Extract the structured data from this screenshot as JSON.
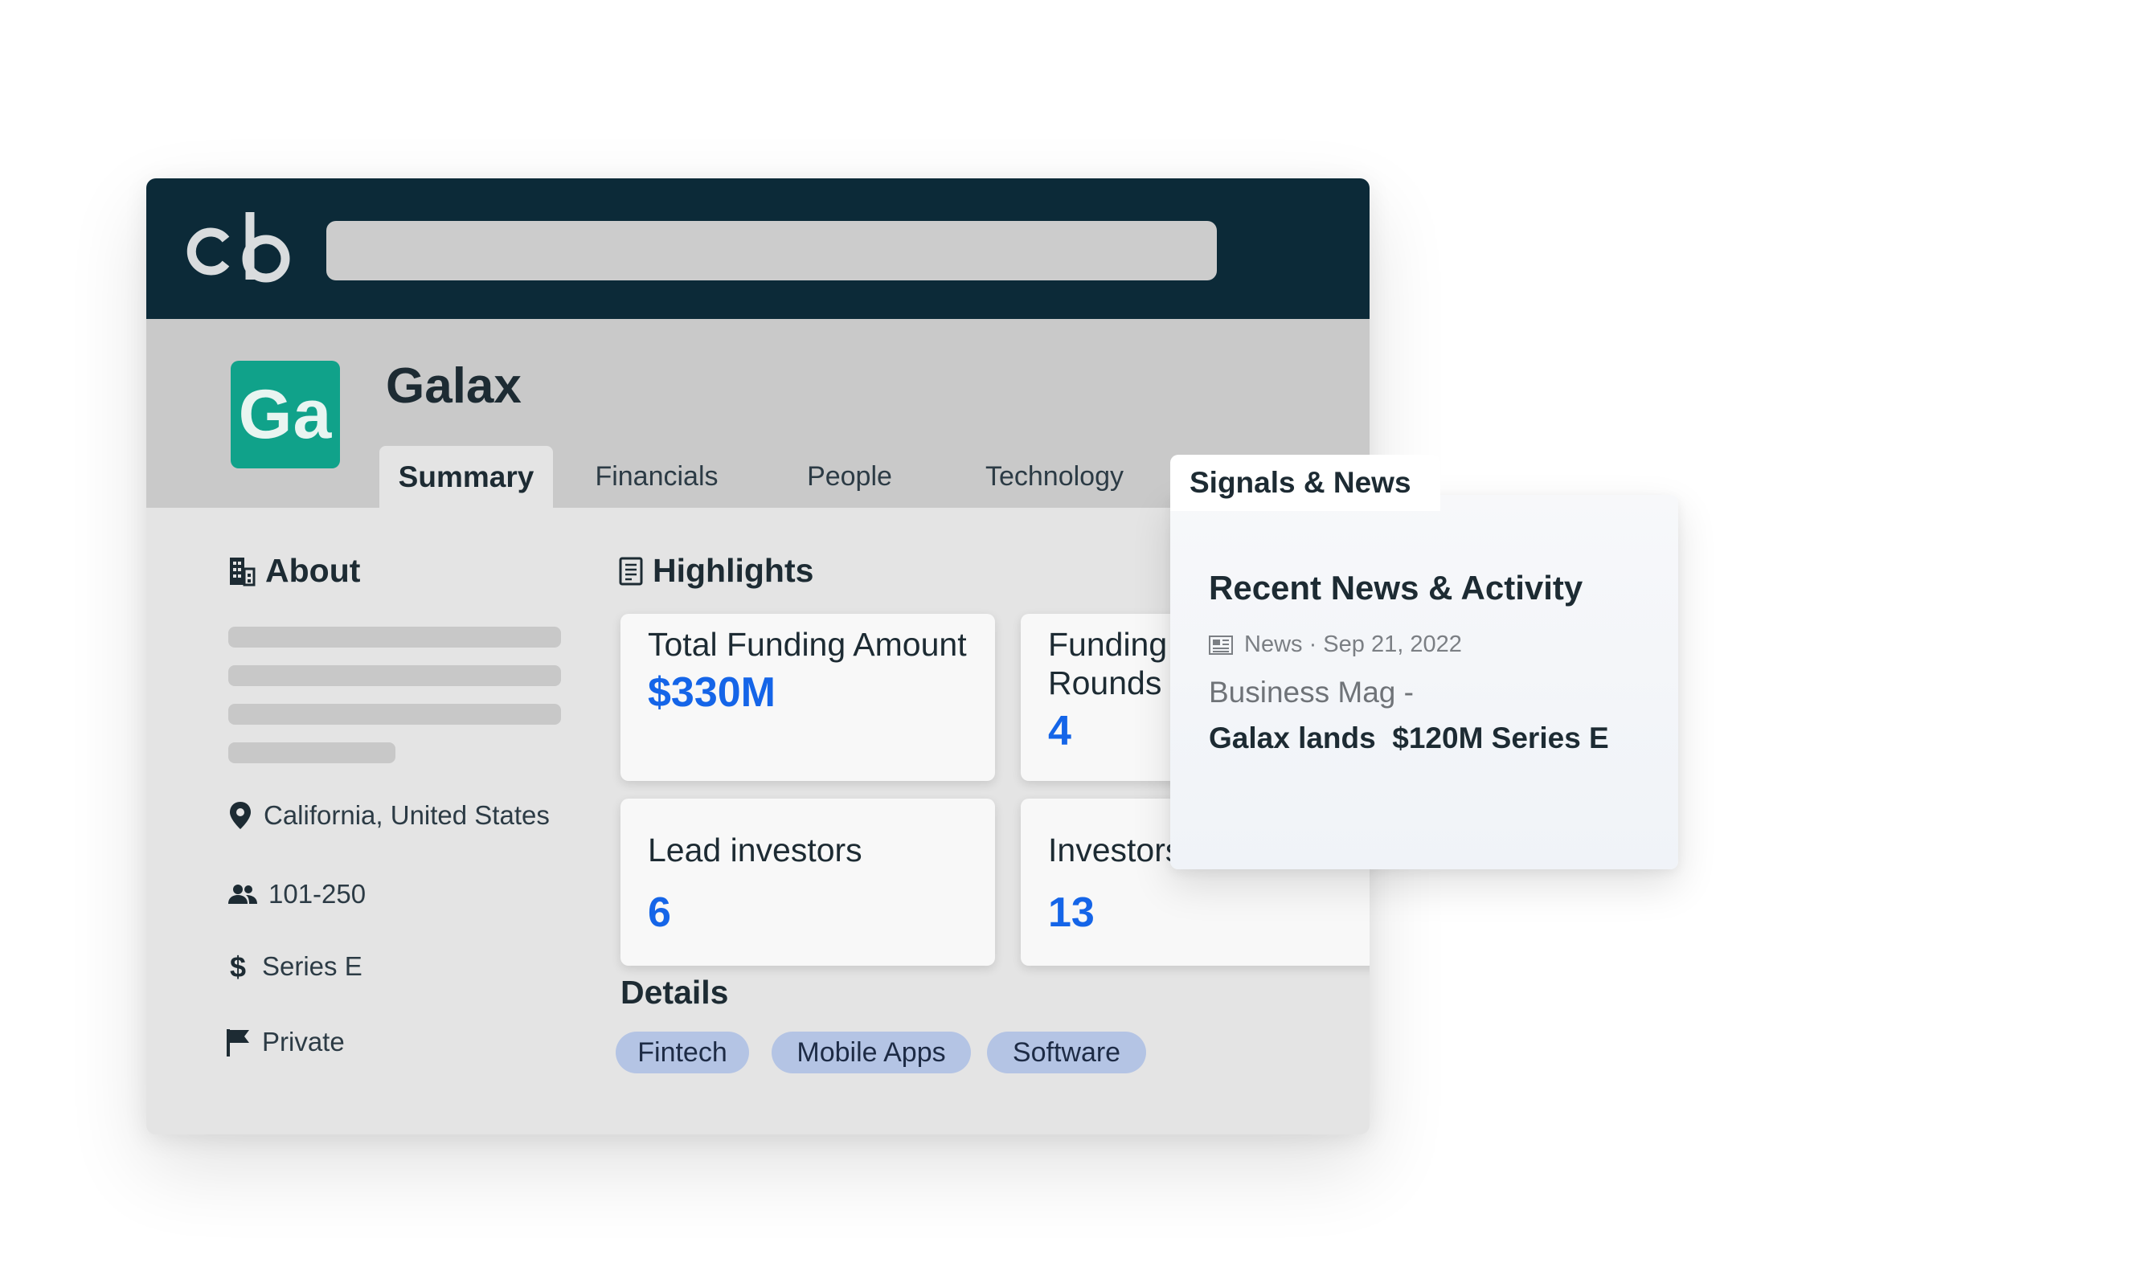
{
  "header": {
    "logo_text": "cb",
    "search_placeholder": ""
  },
  "company": {
    "logo_initials": "Ga",
    "name": "Galax",
    "logo_color": "#10a28a"
  },
  "tabs": [
    {
      "label": "Summary",
      "active": true
    },
    {
      "label": "Financials",
      "active": false
    },
    {
      "label": "People",
      "active": false
    },
    {
      "label": "Technology",
      "active": false
    },
    {
      "label": "Signals & News",
      "active": false
    }
  ],
  "about": {
    "title": "About",
    "location": "California, United States",
    "employees": "101-250",
    "funding_stage": "Series E",
    "status": "Private"
  },
  "highlights": {
    "title": "Highlights",
    "cards": [
      {
        "label": "Total Funding Amount",
        "value": "$330M"
      },
      {
        "label": "Funding Rounds",
        "value": "4"
      },
      {
        "label": "Lead investors",
        "value": "6"
      },
      {
        "label": "Investors",
        "value": "13"
      }
    ]
  },
  "details": {
    "title": "Details",
    "tags": [
      "Fintech",
      "Mobile Apps",
      "Software"
    ]
  },
  "signals": {
    "tab_label": "Signals & News",
    "panel_title": "Recent News & Activity",
    "news_meta": "News · Sep 21, 2022",
    "news_source": "Business Mag -",
    "news_headline": "Galax lands  $120M Series E"
  },
  "colors": {
    "topbar": "#0c2a38",
    "accent_value": "#1565e8",
    "chip": "#b4c4e4"
  }
}
